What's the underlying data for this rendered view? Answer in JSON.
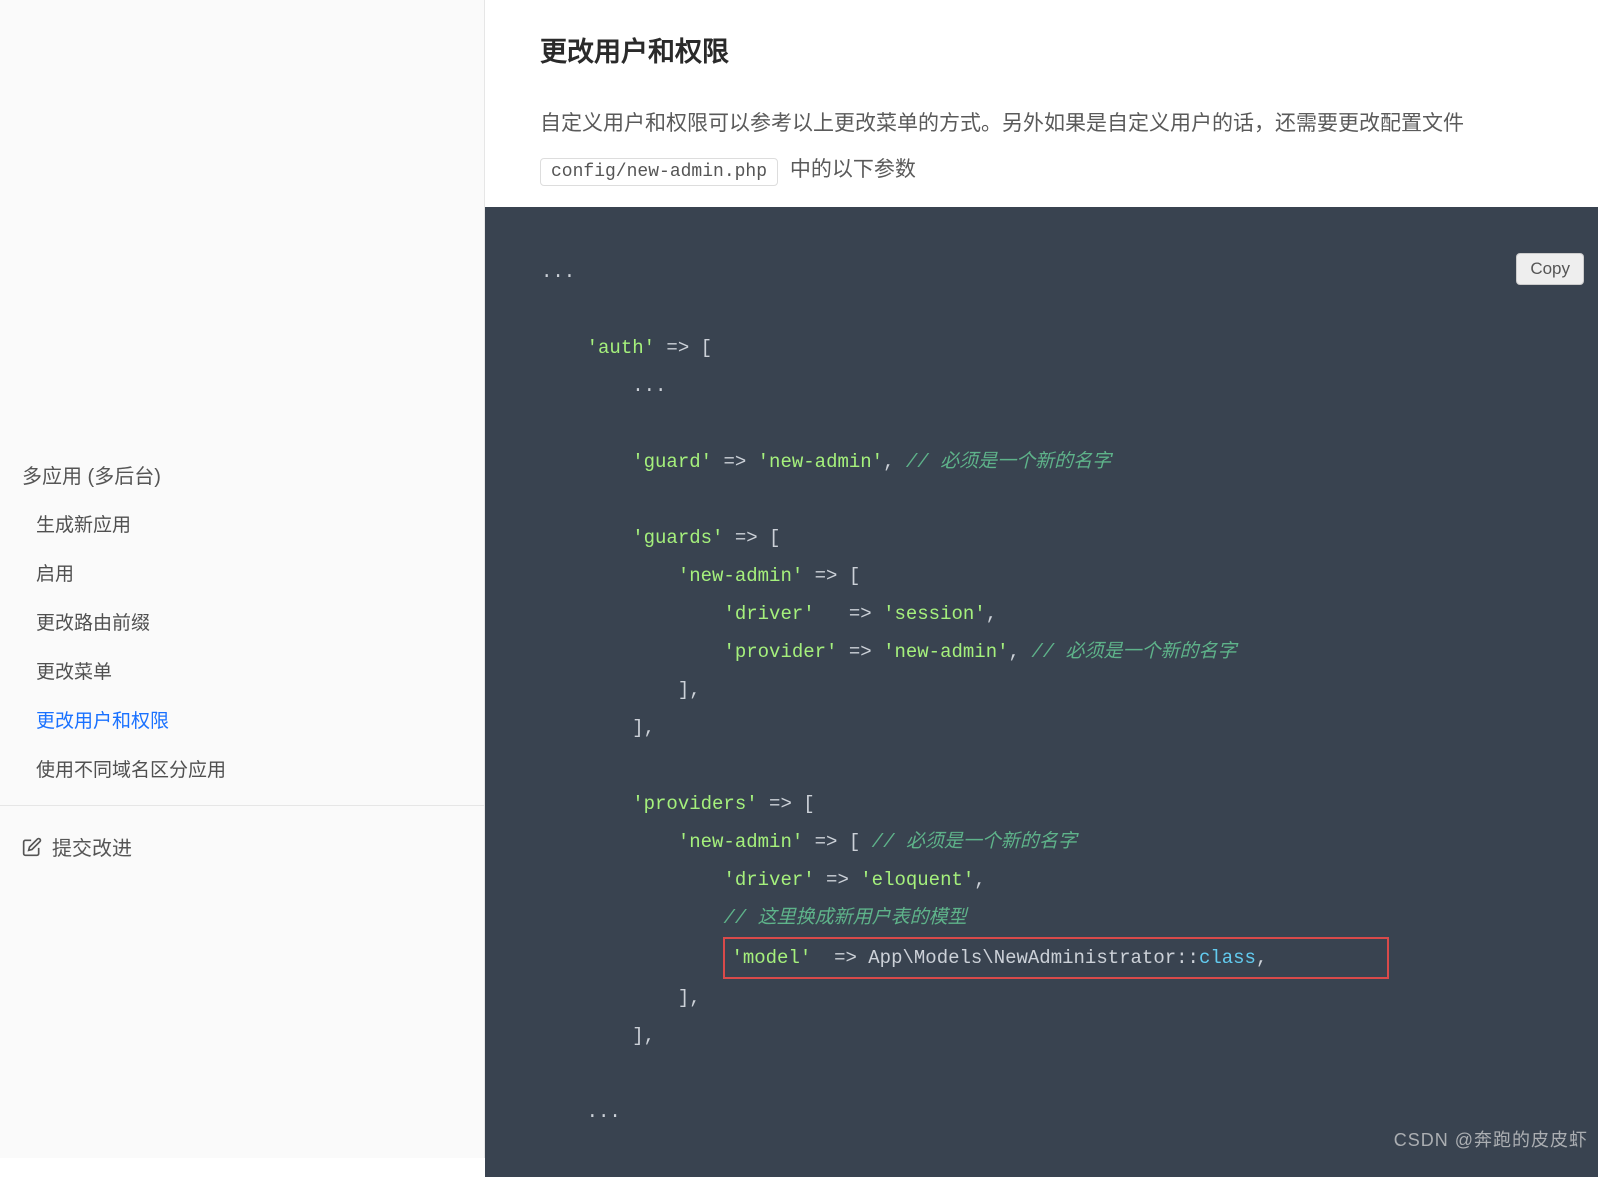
{
  "sidebar": {
    "section_title": "多应用 (多后台)",
    "items": [
      {
        "label": "生成新应用",
        "active": false
      },
      {
        "label": "启用",
        "active": false
      },
      {
        "label": "更改路由前缀",
        "active": false
      },
      {
        "label": "更改菜单",
        "active": false
      },
      {
        "label": "更改用户和权限",
        "active": true
      },
      {
        "label": "使用不同域名区分应用",
        "active": false
      }
    ],
    "submit_label": "提交改进"
  },
  "main": {
    "title": "更改用户和权限",
    "desc_line1": "自定义用户和权限可以参考以上更改菜单的方式。另外如果是自定义用户的话，还需要更改配置文件",
    "desc_code": "config/new-admin.php",
    "desc_line2": "中的以下参数",
    "copy_label": "Copy"
  },
  "code": {
    "l1": "...",
    "l2a": "'auth'",
    "l2b": " => [",
    "l3": "        ...",
    "l4a": "'guard'",
    "l4b": " => ",
    "l4c": "'new-admin'",
    "l4d": ", ",
    "l4e": "// 必须是一个新的名字",
    "l5a": "'guards'",
    "l5b": " => [",
    "l6a": "'new-admin'",
    "l6b": " => [",
    "l7a": "'driver'",
    "l7b": "   => ",
    "l7c": "'session'",
    "l7d": ",",
    "l8a": "'provider'",
    "l8b": " => ",
    "l8c": "'new-admin'",
    "l8d": ", ",
    "l8e": "// 必须是一个新的名字",
    "l9": "            ],",
    "l10": "        ],",
    "l11a": "'providers'",
    "l11b": " => [",
    "l12a": "'new-admin'",
    "l12b": " => [ ",
    "l12c": "// 必须是一个新的名字",
    "l13a": "'driver'",
    "l13b": " => ",
    "l13c": "'eloquent'",
    "l13d": ",",
    "l14": "// 这里换成新用户表的模型",
    "l15a": "'model'",
    "l15b": "  => ",
    "l15c": "App\\Models\\NewAdministrator::",
    "l15d": "class",
    "l15e": ",",
    "l16": "            ],",
    "l17": "        ],",
    "l18": "    ..."
  },
  "watermark": "CSDN @奔跑的皮皮虾"
}
